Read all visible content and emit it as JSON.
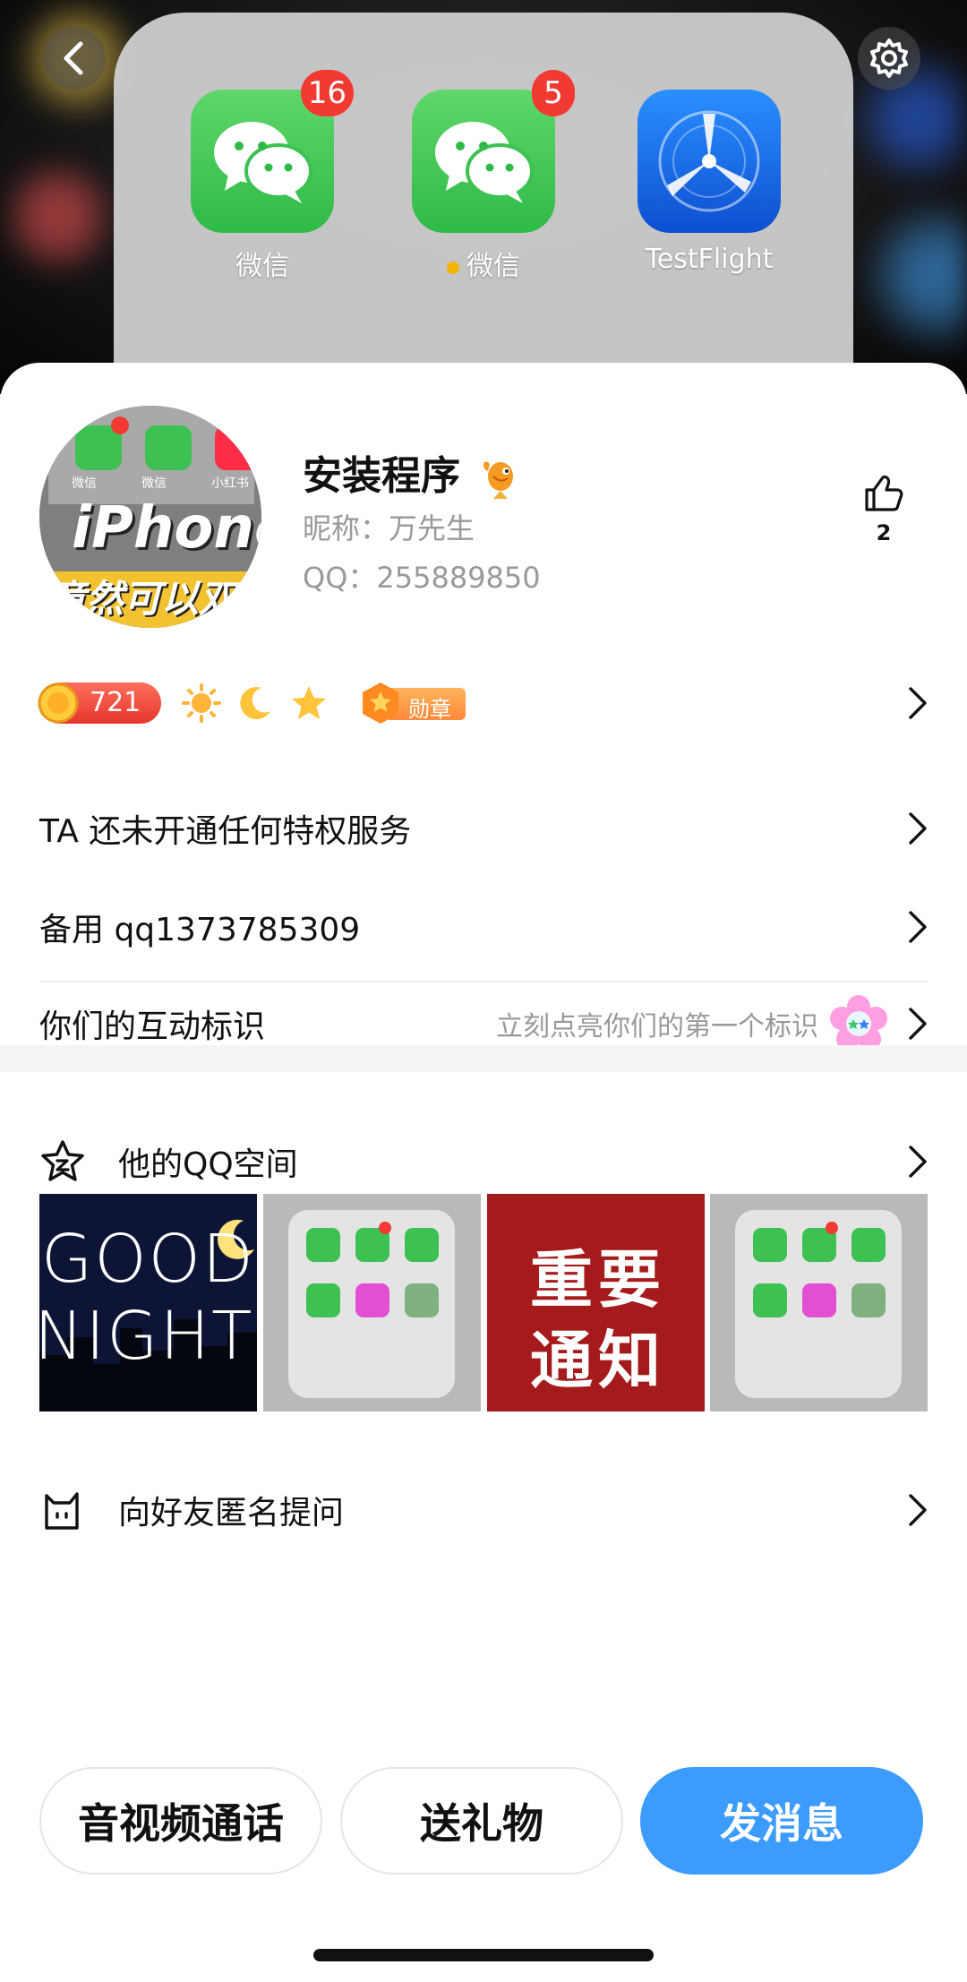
{
  "cover": {
    "apps": [
      {
        "label": "微信",
        "badge": "16",
        "icon": "wechat-icon"
      },
      {
        "label": "微信",
        "badge": "5",
        "icon": "wechat-icon"
      },
      {
        "label": "TestFlight",
        "badge": "",
        "icon": "testflight-icon"
      }
    ],
    "avatar_text_1": "iPhone",
    "avatar_text_2": "竟然可以双开",
    "avatar_apps": [
      "微信",
      "微信",
      "小红书"
    ]
  },
  "profile": {
    "name": "安装程序",
    "nickname": "昵称：万先生",
    "qq": "QQ：255889850",
    "likes": "2"
  },
  "level": {
    "value": "721",
    "medal_label": "勋章"
  },
  "rows": {
    "privilege": "TA 还未开通任何特权服务",
    "backup": "备用 qq1373785309",
    "interaction_label": "你们的互动标识",
    "interaction_hint": "立刻点亮你们的第一个标识",
    "qzone": "他的QQ空间",
    "ask": "向好友匿名提问"
  },
  "photos": [
    {
      "type": "good-night",
      "text_1": "GOOD",
      "text_2": "NIGHT"
    },
    {
      "type": "folder"
    },
    {
      "type": "notice",
      "text_1": "重要",
      "text_2": "通知"
    },
    {
      "type": "folder"
    }
  ],
  "buttons": {
    "call": "音视频通话",
    "gift": "送礼物",
    "message": "发消息"
  },
  "colors": {
    "primary": "#3b9bff",
    "wechat_green": "#2fba48",
    "badge_red": "#f23a33"
  }
}
